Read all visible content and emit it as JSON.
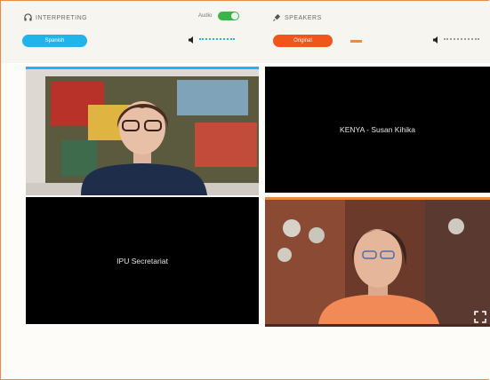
{
  "interpreting": {
    "title": "INTERPRETING",
    "language_button": "Spanish",
    "audio_label": "Audio",
    "audio_on": true,
    "accent": "#1fb5ea"
  },
  "speakers": {
    "title": "SPEAKERS",
    "language_button": "Original",
    "accent": "#f0561c"
  },
  "videos": {
    "tile_top_right_label": "KENYA - Susan Kihika",
    "tile_bottom_left_label": "IPU Secretariat"
  }
}
